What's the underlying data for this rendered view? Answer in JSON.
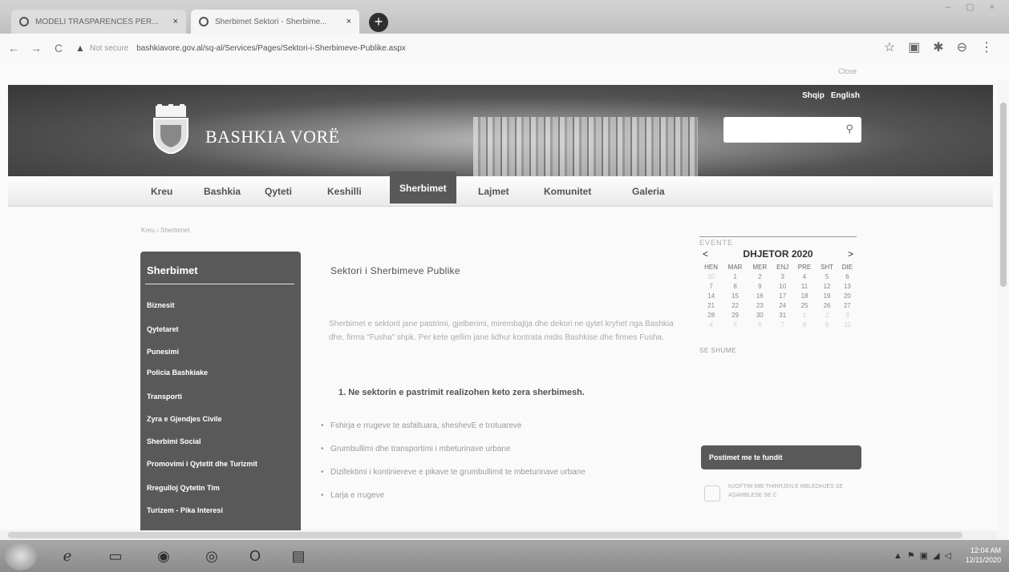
{
  "browser": {
    "tabs": [
      {
        "title": "MODELI TRASPARENCES PER...",
        "close": "×"
      },
      {
        "title": "Sherbimet Sektori - Sherbime...",
        "close": "×"
      }
    ],
    "new_tab": "+",
    "window_controls": "– ▢ ×",
    "url_security": "Not secure",
    "url": "bashkiavore.gov.al/sq-al/Services/Pages/Sektori-i-Sherbimeve-Publike.aspx"
  },
  "site": {
    "close_label": "Close",
    "brand": "BASHKIA VORË",
    "lang_sq": "Shqip",
    "lang_en": "English",
    "search_placeholder": "",
    "nav": [
      "Kreu",
      "Bashkia",
      "Qyteti",
      "Keshilli",
      "Sherbimet",
      "Lajmet",
      "Komunitet",
      "Galeria"
    ],
    "breadcrumb": "Kreu › Sherbimet"
  },
  "sidebar": {
    "heading": "Sherbimet",
    "items": [
      "Biznesit",
      "Qytetaret",
      "Punesimi",
      "Policia Bashkiake",
      "Transporti",
      "Zyra e Gjendjes Civile",
      "Sherbimi Social",
      "Promovimi i Qytetit dhe Turizmit",
      "Rregulloj Qytetin Tim",
      "Turizem - Pika Interesi"
    ]
  },
  "content": {
    "title": "Sektori i Sherbimeve Publike",
    "paragraph": "Sherbimet e sektorit jane pastrimi, gjelberimi, mirembajtja dhe dekori ne qytet kryhet nga Bashkia dhe, firma \"Fusha\" shpk. Per kete qellim jane lidhur kontrata midis Bashkise dhe firmes Fusha.",
    "subheading": "1. Ne sektorin e pastrimit realizohen keto zera sherbimesh.",
    "bullets": [
      "Fshirja e rrugeve te asfaltuara, sheshevE e trotuareve",
      "Grumbullimi dhe transportimi i mbeturinave urbane",
      "Dizifektimi i kontiniereve e pikave te grumbullimit te mbeturinave urbane",
      "Larja e rrugeve"
    ]
  },
  "events": {
    "label": "EVENTE",
    "month": "DHJETOR 2020",
    "prev": "<",
    "next": ">",
    "weekdays": [
      "HEN",
      "MAR",
      "MER",
      "ENJ",
      "PRE",
      "SHT",
      "DIE"
    ],
    "weeks": [
      [
        "30",
        "1",
        "2",
        "3",
        "4",
        "5",
        "6"
      ],
      [
        "7",
        "8",
        "9",
        "10",
        "11",
        "12",
        "13"
      ],
      [
        "14",
        "15",
        "16",
        "17",
        "18",
        "19",
        "20"
      ],
      [
        "21",
        "22",
        "23",
        "24",
        "25",
        "26",
        "27"
      ],
      [
        "28",
        "29",
        "30",
        "31",
        "1",
        "2",
        "3"
      ],
      [
        "4",
        "5",
        "6",
        "7",
        "8",
        "9",
        "10"
      ]
    ],
    "see_more": "SE SHUME"
  },
  "postimet": {
    "heading": "Postimet me te fundit",
    "notice": "NJOFTIM MBI THIRRJEN E MBLEDHJES SE ASAMBLESE SE C"
  },
  "taskbar": {
    "time": "12:04 AM",
    "date": "12/11/2020"
  }
}
